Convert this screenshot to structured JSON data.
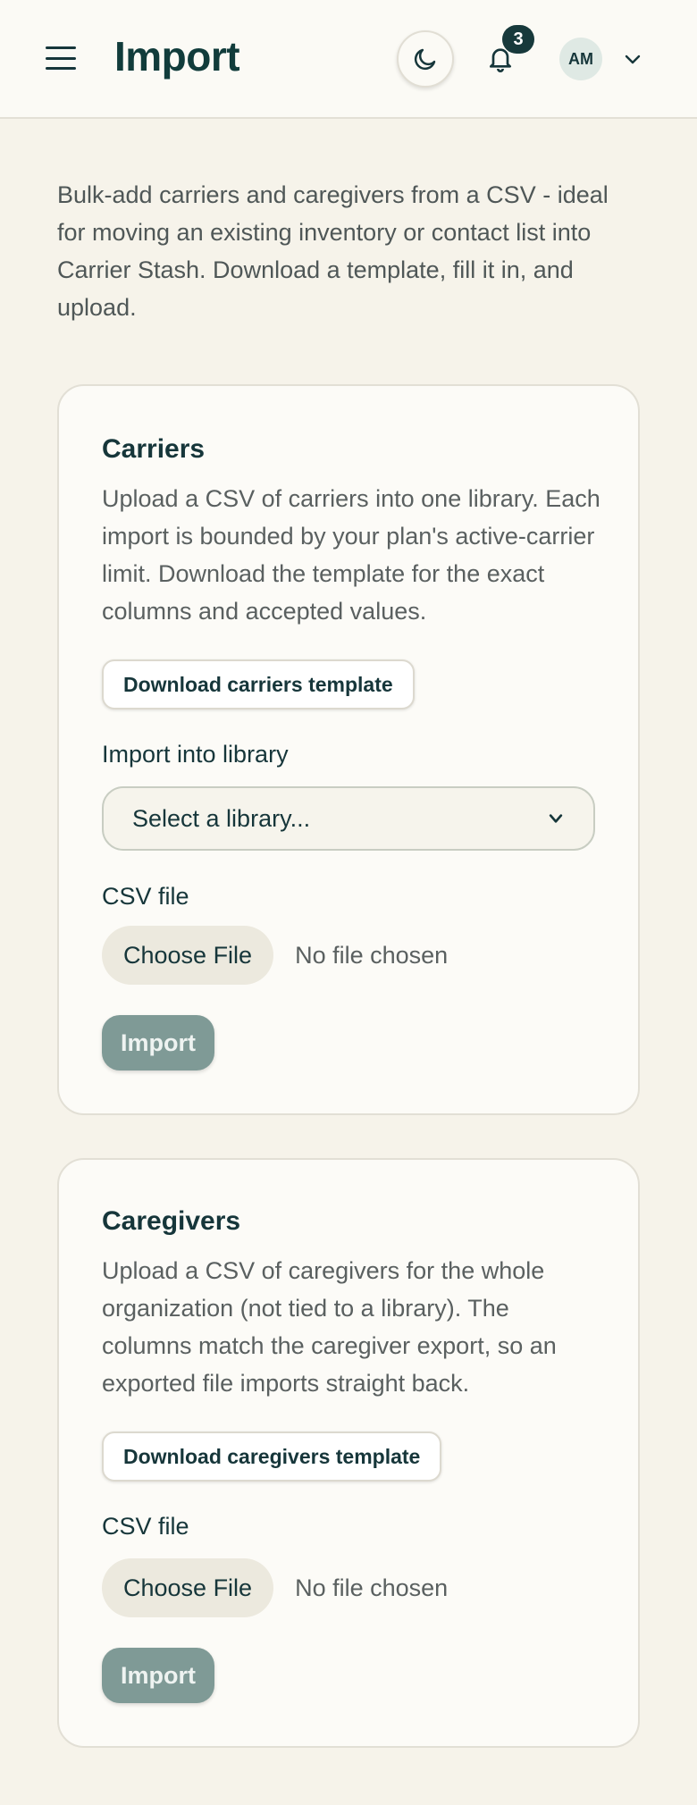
{
  "header": {
    "title": "Import",
    "notification_count": "3",
    "avatar_initials": "AM"
  },
  "intro": "Bulk-add carriers and caregivers from a CSV - ideal for moving an existing inventory or contact list into Carrier Stash. Download a template, fill it in, and upload.",
  "carriers": {
    "title": "Carriers",
    "description": "Upload a CSV of carriers into one library. Each import is bounded by your plan's active-carrier limit. Download the template for the exact columns and accepted values.",
    "template_button": "Download carriers template",
    "library_label": "Import into library",
    "library_select": "Select a library...",
    "file_label": "CSV file",
    "choose_file": "Choose File",
    "file_status": "No file chosen",
    "import_button": "Import"
  },
  "caregivers": {
    "title": "Caregivers",
    "description": "Upload a CSV of caregivers for the whole organization (not tied to a library). The columns match the caregiver export, so an exported file imports straight back.",
    "template_button": "Download caregivers template",
    "file_label": "CSV file",
    "choose_file": "Choose File",
    "file_status": "No file chosen",
    "import_button": "Import"
  },
  "colors": {
    "background": "#f6f3ea",
    "primary_text": "#16363a",
    "import_button": "#7f9a96"
  }
}
